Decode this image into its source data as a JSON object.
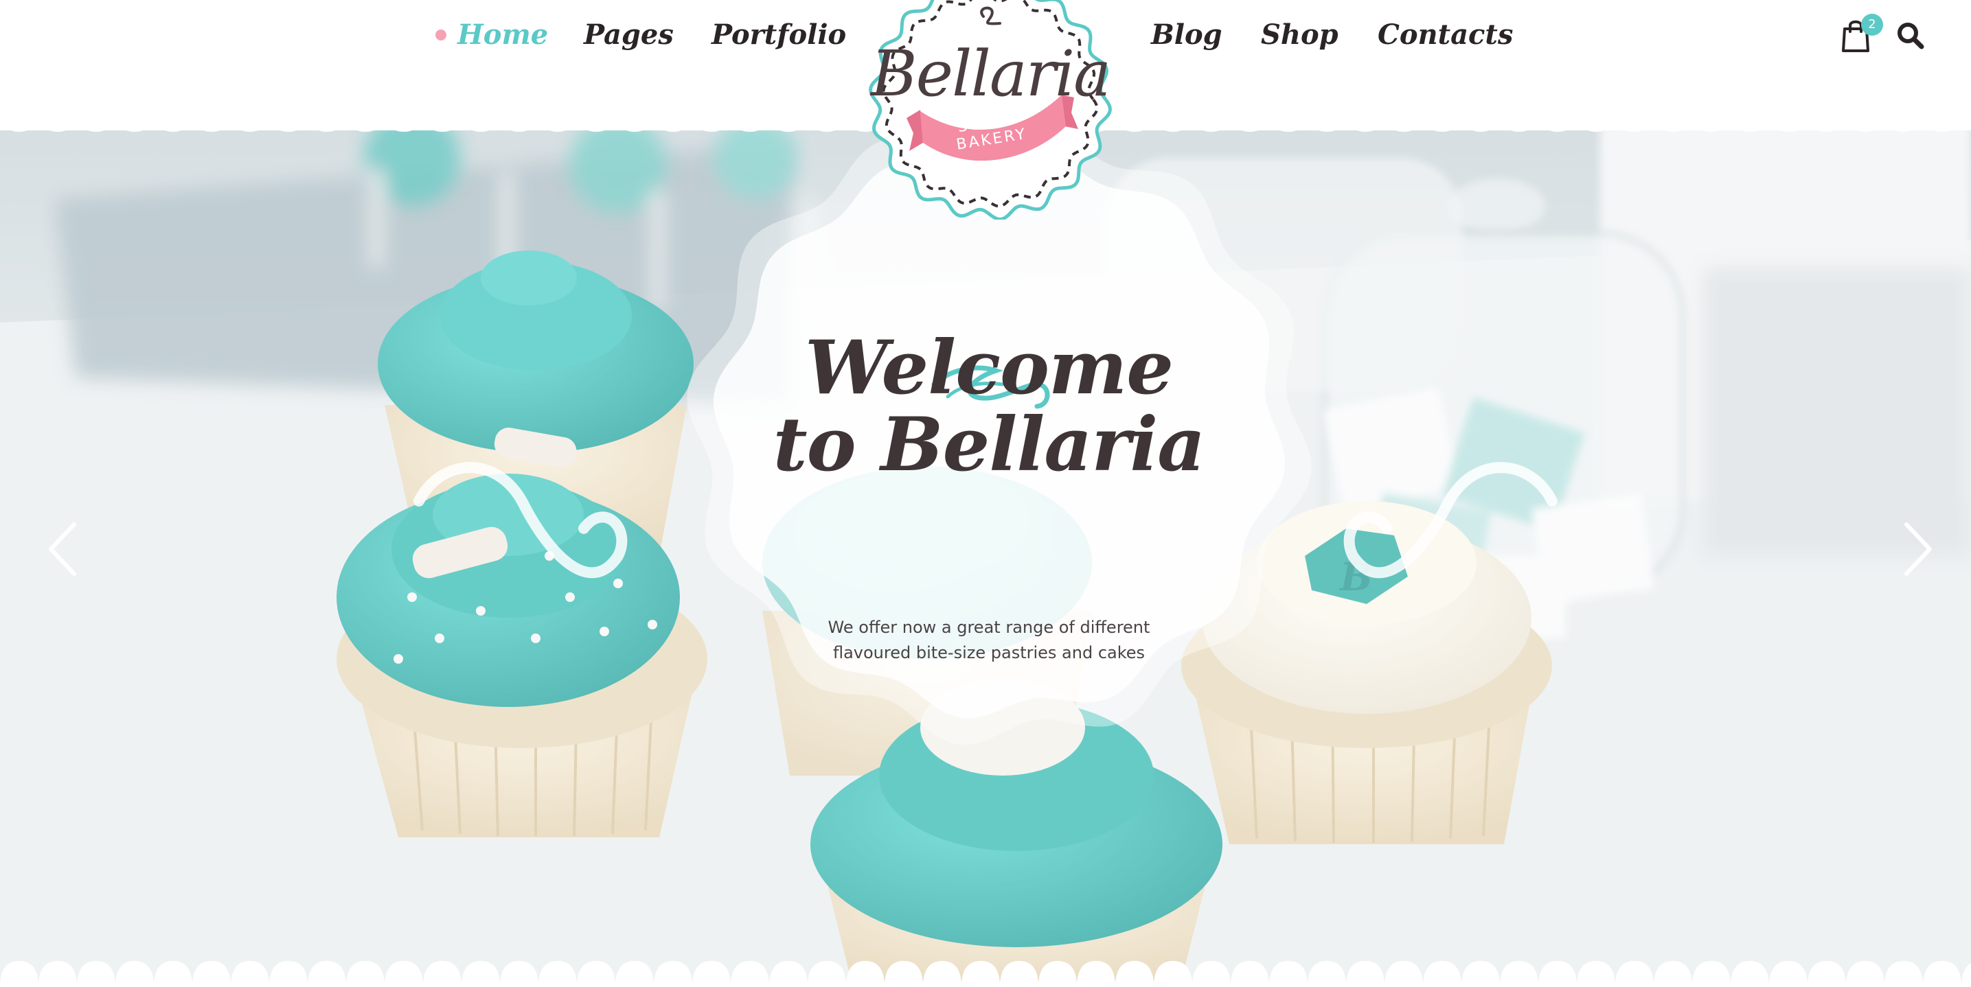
{
  "nav": {
    "left": [
      {
        "label": "Home",
        "active": true
      },
      {
        "label": "Pages",
        "active": false
      },
      {
        "label": "Portfolio",
        "active": false
      }
    ],
    "right": [
      {
        "label": "Blog",
        "active": false
      },
      {
        "label": "Shop",
        "active": false
      },
      {
        "label": "Contacts",
        "active": false
      }
    ]
  },
  "logo": {
    "name": "Bellaria",
    "tagline": "SWEET BAKERY"
  },
  "header_actions": {
    "cart_icon": "shopping-bag-icon",
    "cart_count": "2",
    "search_icon": "search-icon"
  },
  "hero": {
    "title_line1": "Welcome",
    "title_line2": "to Bellaria",
    "subtitle_line1": "We offer now a great range of different",
    "subtitle_line2": "flavoured bite-size pastries and cakes",
    "prev_icon": "chevron-left-icon",
    "next_icon": "chevron-right-icon"
  },
  "colors": {
    "accent": "#5bc9c6",
    "pink": "#f6a1b4",
    "text_dark": "#2a2426",
    "heading": "#3f3537"
  }
}
